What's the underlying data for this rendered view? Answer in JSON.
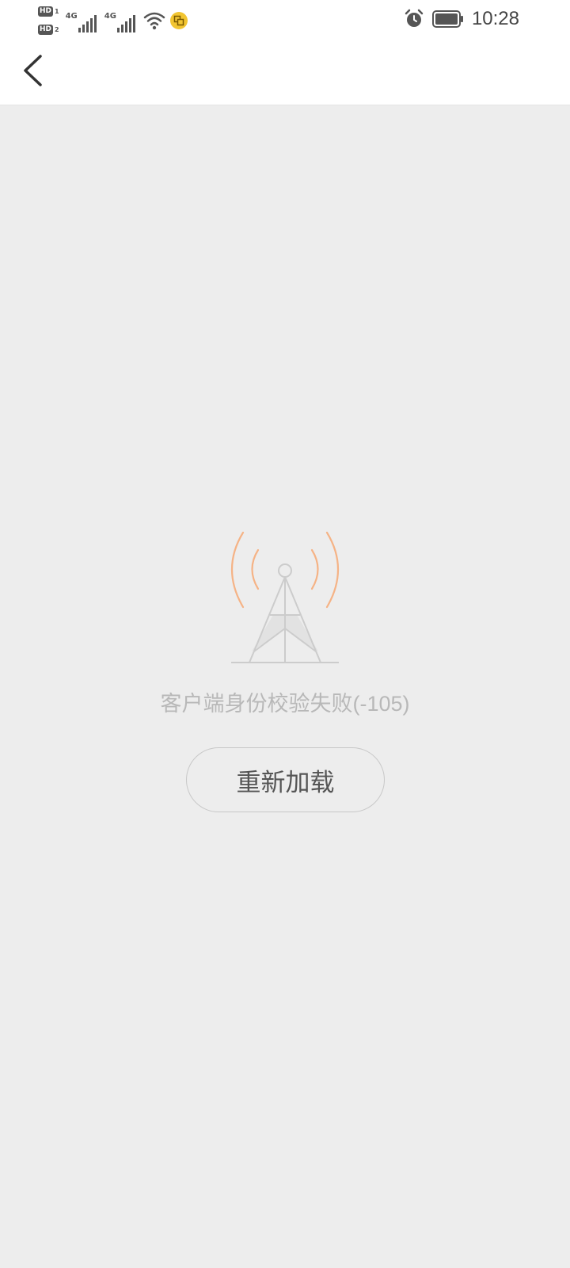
{
  "status_bar": {
    "sim1_badge": "HD",
    "sim1_number": "1",
    "sim2_badge": "HD",
    "sim2_number": "2",
    "network1_type": "4G",
    "network2_type": "4G",
    "wifi_icon": "wifi-icon",
    "notification_icon": "copy-app-icon",
    "alarm_icon": "alarm-icon",
    "battery_icon": "battery-icon",
    "time": "10:28"
  },
  "nav": {
    "back_icon": "chevron-left-icon"
  },
  "error": {
    "illustration_icon": "signal-tower-icon",
    "message": "客户端身份校验失败(-105)",
    "reload_label": "重新加载"
  },
  "colors": {
    "background": "#ededed",
    "header_bg": "#ffffff",
    "signal_wave": "#f5b386",
    "tower_stroke": "#cccccc",
    "message_text": "#b8b8b8",
    "button_text": "#555555",
    "button_border": "#c8c8c8"
  }
}
